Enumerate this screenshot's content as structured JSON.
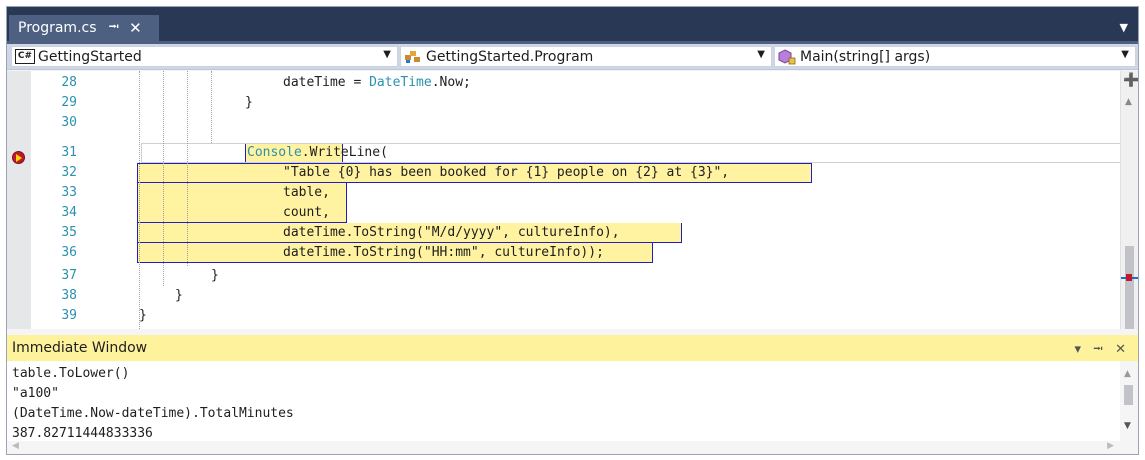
{
  "tab": {
    "name": "Program.cs",
    "pin_glyph": "⭲",
    "close_glyph": "✕",
    "dropdown_glyph": "▼"
  },
  "navbar": {
    "project": "GettingStarted",
    "cs_badge": "C#",
    "class": "GettingStarted.Program",
    "member": "Main(string[] args)",
    "arrow": "▼"
  },
  "editor": {
    "lines": [
      {
        "num": "28"
      },
      {
        "num": "29"
      },
      {
        "num": "30"
      },
      {
        "num": "31"
      },
      {
        "num": "32"
      },
      {
        "num": "33"
      },
      {
        "num": "34"
      },
      {
        "num": "35"
      },
      {
        "num": "36"
      },
      {
        "num": "37"
      },
      {
        "num": "38"
      },
      {
        "num": "39"
      }
    ],
    "code": {
      "l28a": "dateTime = ",
      "l28b": "DateTime",
      "l28c": ".Now;",
      "l29": "}",
      "l31a": "Console",
      "l31b": ".WriteLine(",
      "l32": "\"Table {0} has been booked for {1} people on {2} at {3}\",",
      "l33": "table,",
      "l34": "count,",
      "l35a": "dateTime.ToString(",
      "l35b": "\"M/d/yyyy\"",
      "l35c": ", cultureInfo),",
      "l36a": "dateTime.ToString(",
      "l36b": "\"HH:mm\"",
      "l36c": ", cultureInfo));",
      "l37": "}",
      "l38": "}",
      "l39": "}"
    },
    "split_glyph": "➕"
  },
  "immediate": {
    "title": "Immediate Window",
    "tools": "▾ ⭲ ✕",
    "output": [
      "table.ToLower()",
      "\"a100\"",
      "(DateTime.Now-dateTime).TotalMinutes",
      "387.82711444833336"
    ]
  },
  "colors": {
    "tab_bg": "#293955",
    "active_tab": "#4d6082",
    "highlight": "#fff2a0",
    "highlight_border": "#2020c0",
    "line_numbers": "#2b91af",
    "immediate_header": "#fff29d"
  }
}
